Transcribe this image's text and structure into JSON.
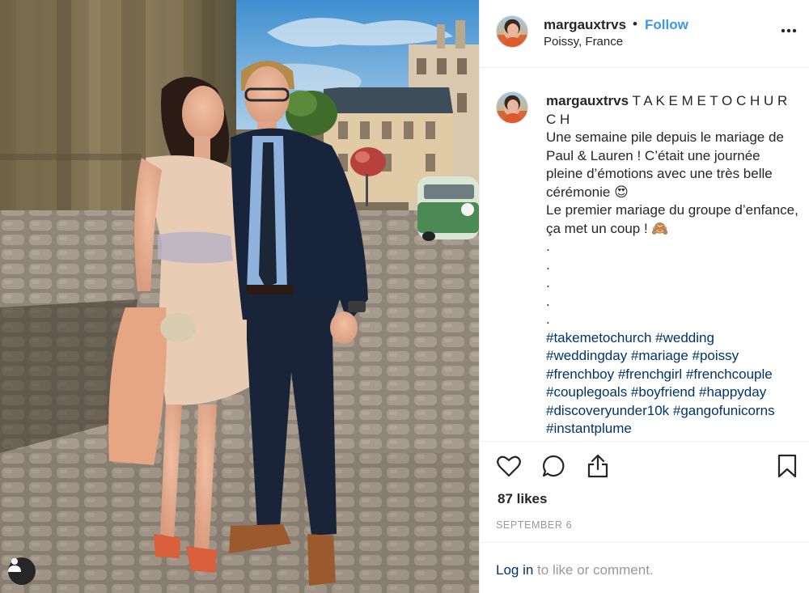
{
  "post": {
    "author": {
      "username": "margauxtrvs",
      "location": "Poissy, France",
      "follow_label": "Follow",
      "separator": "•",
      "avatar_icon": "profile-avatar"
    },
    "caption": {
      "username": "margauxtrvs",
      "text": " T A K E M E T O C H U R C H\nUne semaine pile depuis le mariage de Paul & Lauren ! C’était une journée pleine d’émotions avec une très belle cérémonie 😍\nLe premier mariage du groupe d’enfance, ça met un coup ! 🙈\n.\n.\n.\n.\n.\n",
      "hashtags": "#takemetochurch #wedding #weddingday #mariage #poissy #frenchboy #frenchgirl #frenchcouple #couplegoals #boyfriend #happyday #discoveryunder10k #gangofunicorns #instantplume"
    },
    "likes": "87 likes",
    "date": "SEPTEMBER 6",
    "login": {
      "link": "Log in",
      "rest": " to like or comment."
    },
    "icons": {
      "more": "more-options-icon",
      "like": "heart-icon",
      "comment": "comment-icon",
      "share": "share-icon",
      "save": "bookmark-icon",
      "tag": "user-tag-icon"
    }
  },
  "colors": {
    "link_blue": "#3897f0",
    "hashtag_blue": "#003569",
    "muted_gray": "#999999",
    "text": "#262626",
    "divider": "#efefef"
  }
}
